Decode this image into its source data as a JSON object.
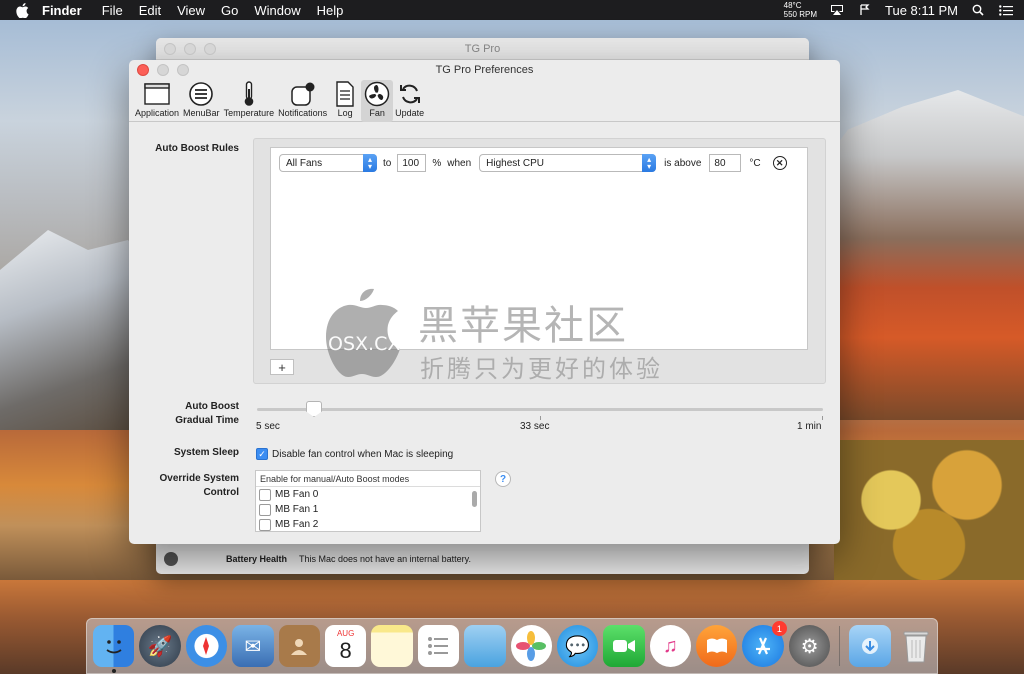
{
  "menubar": {
    "app_name": "Finder",
    "items": [
      "File",
      "Edit",
      "View",
      "Go",
      "Window",
      "Help"
    ],
    "temp": "48°C",
    "rpm": "550 RPM",
    "clock": "Tue 8:11 PM"
  },
  "bg_window": {
    "title": "TG Pro",
    "battery_label": "Battery Health",
    "battery_text": "This Mac does not have an internal battery."
  },
  "prefs": {
    "title": "TG Pro Preferences",
    "toolbar": [
      {
        "label": "Application",
        "icon": "application-icon"
      },
      {
        "label": "MenuBar",
        "icon": "menubar-icon"
      },
      {
        "label": "Temperature",
        "icon": "thermometer-icon"
      },
      {
        "label": "Notifications",
        "icon": "notifications-icon"
      },
      {
        "label": "Log",
        "icon": "log-icon"
      },
      {
        "label": "Fan",
        "icon": "fan-icon"
      },
      {
        "label": "Update",
        "icon": "update-icon"
      }
    ],
    "selected_tab": "Fan",
    "auto_boost_label": "Auto Boost  Rules",
    "rule": {
      "fan_select": "All Fans",
      "to": "to",
      "percent": "100",
      "percent_unit": "%",
      "when": "when",
      "sensor_select": "Highest CPU",
      "condition": "is above",
      "threshold": "80",
      "unit": "°C"
    },
    "add_button": "+",
    "gradual_label_1": "Auto Boost",
    "gradual_label_2": "Gradual Time",
    "slider": {
      "min_label": "5 sec",
      "mid_label": "33 sec",
      "max_label": "1 min",
      "value_fraction": 0.1
    },
    "system_sleep_label": "System Sleep",
    "sleep_checkbox_label": "Disable fan control when Mac is sleeping",
    "sleep_checked": true,
    "override_label_1": "Override System",
    "override_label_2": "Control",
    "override_header": "Enable for manual/Auto Boost modes",
    "override_items": [
      "MB Fan 0",
      "MB Fan 1",
      "MB Fan 2"
    ],
    "help": "?"
  },
  "watermark": {
    "title": "黑苹果社区",
    "domain": "OSX.CX",
    "subtitle": "折腾只为更好的体验"
  },
  "dock": {
    "apps": [
      "Finder",
      "Launchpad",
      "Safari",
      "Mail",
      "Contacts",
      "Calendar",
      "Notes",
      "Reminders",
      "Preview",
      "Photos",
      "Messages",
      "FaceTime",
      "iTunes",
      "iBooks",
      "App Store",
      "System Preferences",
      "Downloads",
      "Trash"
    ],
    "calendar_month": "AUG",
    "calendar_day": "8",
    "appstore_badge": "1"
  }
}
